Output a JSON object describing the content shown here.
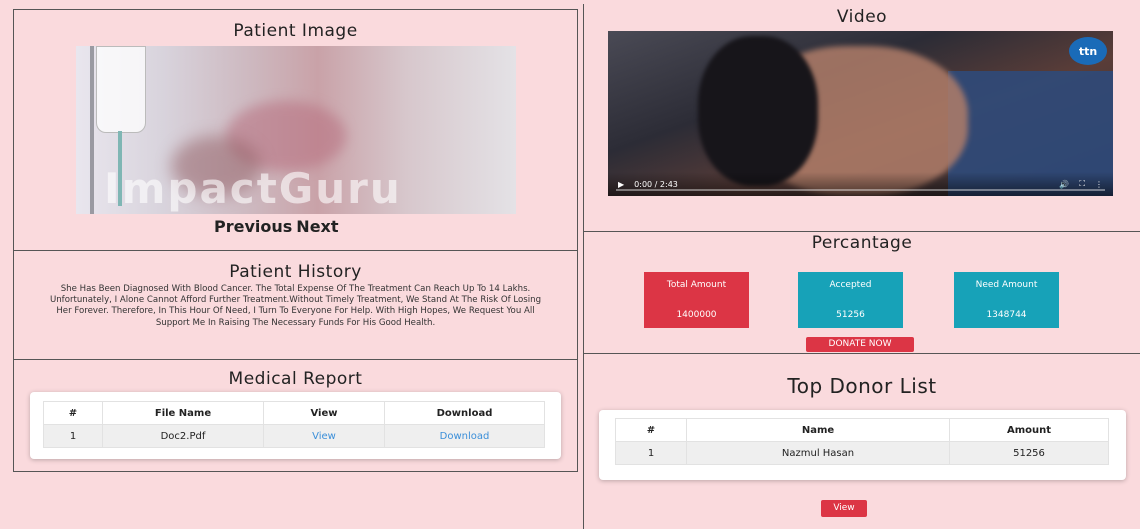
{
  "patient_image": {
    "title": "Patient Image",
    "watermark": "ImpactGuru",
    "previous": "Previous",
    "next": "Next"
  },
  "history": {
    "title": "Patient History",
    "text": "She Has Been Diagnosed With Blood Cancer. The Total Expense Of The Treatment Can Reach Up To 14 Lakhs. Unfortunately, I Alone Cannot Afford Further Treatment.Without Timely Treatment, We Stand At The Risk Of Losing Her Forever. Therefore, In This Hour Of Need, I Turn To Everyone For Help. With High Hopes, We Request You All Support Me In Raising The Necessary Funds For His Good Health."
  },
  "medical": {
    "title": "Medical Report",
    "headers": [
      "#",
      "File Name",
      "View",
      "Download"
    ],
    "rows": [
      {
        "num": "1",
        "file": "Doc2.Pdf",
        "view": "View",
        "download": "Download"
      }
    ]
  },
  "video": {
    "title": "Video",
    "logo": "ttn",
    "time": "0:00 / 2:43",
    "play_icon": "play-icon",
    "volume_icon": "volume-icon",
    "fullscreen_icon": "fullscreen-icon",
    "more_icon": "more-vert-icon"
  },
  "percentage": {
    "title": "Percantage",
    "stats": [
      {
        "label": "Total Amount",
        "value": "1400000",
        "color": "#dc3545"
      },
      {
        "label": "Accepted",
        "value": "51256",
        "color": "#17a2b8"
      },
      {
        "label": "Need Amount",
        "value": "1348744",
        "color": "#17a2b8"
      }
    ],
    "donate": "DONATE NOW"
  },
  "donors": {
    "title": "Top Donor List",
    "headers": [
      "#",
      "Name",
      "Amount"
    ],
    "rows": [
      {
        "num": "1",
        "name": "Nazmul Hasan",
        "amount": "51256"
      }
    ],
    "view": "View"
  }
}
